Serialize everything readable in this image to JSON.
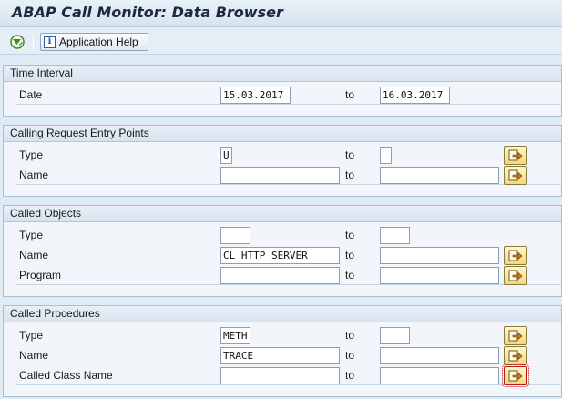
{
  "window": {
    "title": "ABAP Call Monitor: Data Browser"
  },
  "toolbar": {
    "execute_icon": "execute-icon",
    "help_label": "Application Help",
    "help_icon": "info-icon"
  },
  "to_label": "to",
  "groups": [
    {
      "title": "Time Interval",
      "rows": [
        {
          "label": "Date",
          "from": "15.03.2017",
          "to": "16.03.2017"
        }
      ]
    },
    {
      "title": "Calling Request Entry Points",
      "rows": [
        {
          "label": "Type",
          "from": "U",
          "to": ""
        },
        {
          "label": "Name",
          "from": "",
          "to": ""
        }
      ]
    },
    {
      "title": "Called Objects",
      "rows": [
        {
          "label": "Type",
          "from": "",
          "to": ""
        },
        {
          "label": "Name",
          "from": "CL_HTTP_SERVER",
          "to": ""
        },
        {
          "label": "Program",
          "from": "",
          "to": ""
        }
      ]
    },
    {
      "title": "Called Procedures",
      "rows": [
        {
          "label": "Type",
          "from": "METH",
          "to": ""
        },
        {
          "label": "Name",
          "from": "TRACE",
          "to": ""
        },
        {
          "label": "Called Class Name",
          "from": "",
          "to": ""
        }
      ]
    }
  ]
}
